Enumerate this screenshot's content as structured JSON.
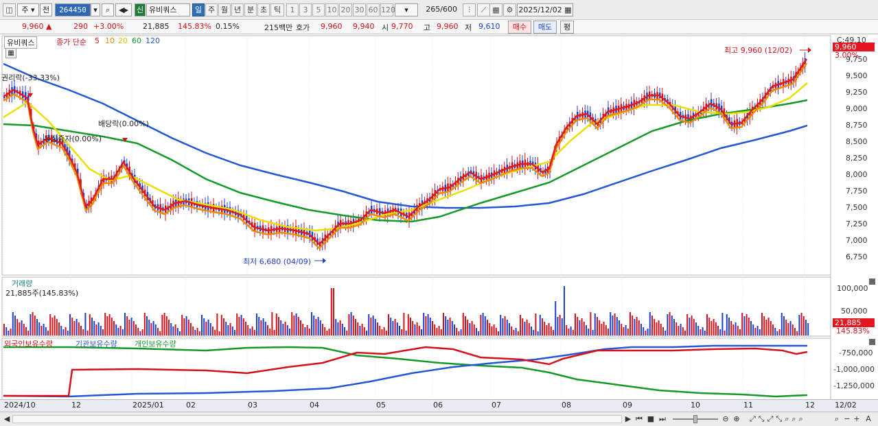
{
  "toolbar": {
    "period_sel": "주",
    "prev_label": "전",
    "code": "264450",
    "market_badge": "신",
    "name": "유비쿼스",
    "tabs": [
      "일",
      "주",
      "월",
      "년",
      "분",
      "초",
      "틱"
    ],
    "nums": [
      "1",
      "3",
      "5",
      "10",
      "20",
      "30",
      "60",
      "120"
    ],
    "count": "265",
    "count_total": "/600",
    "date": "2025/12/02"
  },
  "quote": {
    "price": "9,960",
    "up_arrow": "▲",
    "change": "290",
    "pct": "+3.00%",
    "volume": "21,885",
    "vol_ratio": "145.83%",
    "turnover": "0.15%",
    "amount": "215백만",
    "hoga_label": "호가",
    "ask": "9,960",
    "bid": "9,940",
    "open_label": "시",
    "open": "9,770",
    "high_label": "고",
    "high": "9,960",
    "low_label": "저",
    "low": "9,610",
    "buy_btn": "매수",
    "sell_btn": "매도",
    "eval_btn": "평"
  },
  "price_panel": {
    "legend_name": "유비쿼스",
    "legend_ma": "종가 단순",
    "ma_periods": [
      "5",
      "10",
      "20",
      "60",
      "120"
    ],
    "ma_colors": [
      "#e01a1a",
      "#f08a00",
      "#e8e000",
      "#159a2a",
      "#2456d6"
    ],
    "header_value": "C:49.10",
    "current_price": "9,960",
    "current_pct": "3.00%",
    "y_ticks": [
      "9,750",
      "9,500",
      "9,250",
      "9,000",
      "8,750",
      "8,500",
      "8,250",
      "8,000",
      "7,750",
      "7,500",
      "7,250",
      "7,000",
      "6,750"
    ],
    "annotations": {
      "rights": "권리락(-33.33%)",
      "dividend": "배당락(0.00%)",
      "bonus": "무상증자(0.00%)",
      "high": "최고 9,960 (12/02)",
      "low": "최저 6,680 (04/09)"
    }
  },
  "volume_panel": {
    "title": "거래량",
    "value": "21,885주(145.83%)",
    "y_ticks": [
      "100,000",
      "50,000"
    ],
    "current": "21,885",
    "current_pct": "145.83%"
  },
  "holding_panel": {
    "series": [
      "외국인보유수량",
      "기관보유수량",
      "개인보유수량"
    ],
    "colors": [
      "#d4121b",
      "#2456d6",
      "#159a2a"
    ],
    "y_ticks": [
      "-750,000",
      "-1,000,000",
      "-1,250,000"
    ]
  },
  "x_axis": [
    "2024/10",
    "12",
    "2025/01",
    "02",
    "03",
    "04",
    "05",
    "06",
    "07",
    "08",
    "09",
    "10",
    "11",
    "12"
  ],
  "x_axis_right": "12/02"
}
